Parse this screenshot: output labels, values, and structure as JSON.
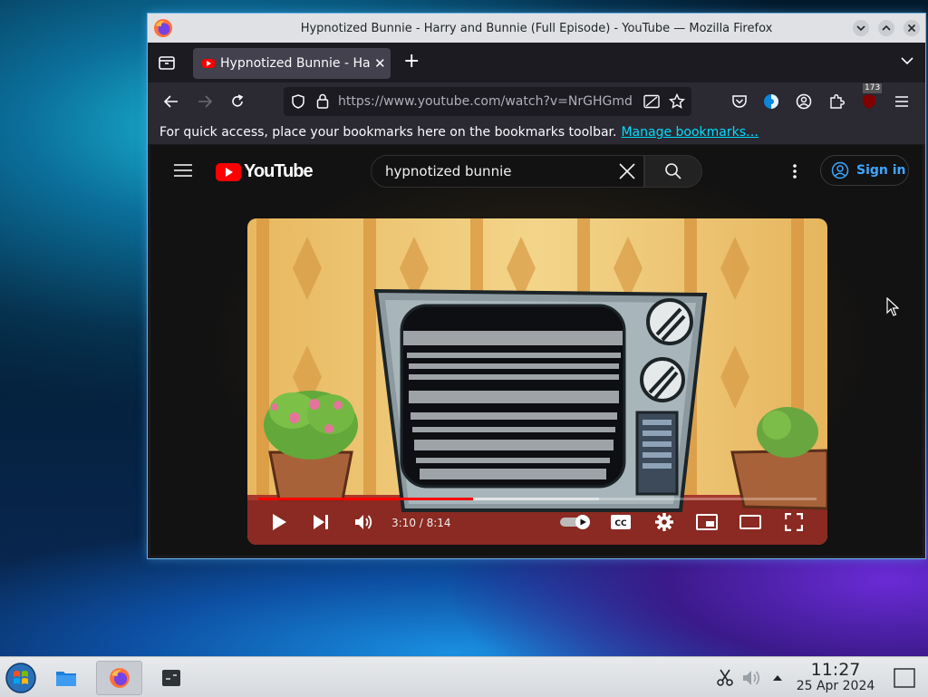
{
  "window": {
    "title": "Hypnotized Bunnie - Harry and Bunnie (Full Episode) - YouTube — Mozilla Firefox"
  },
  "tab": {
    "title": "Hypnotized Bunnie - Harry and Bunnie (Full Episode)",
    "close_glyph": "✕",
    "new_tab_glyph": "+"
  },
  "navbar": {
    "url": "https://www.youtube.com/watch?v=NrGHGmd",
    "extension_badge": "173"
  },
  "bookmarks_bar": {
    "message": "For quick access, place your bookmarks here on the bookmarks toolbar.",
    "manage_link": "Manage bookmarks…"
  },
  "youtube": {
    "logo_text": "YouTube",
    "search_value": "hypnotized bunnie",
    "sign_in": "Sign in"
  },
  "player": {
    "time": "3:10 / 8:14",
    "progress_played": 0.385,
    "progress_buffered": 0.61
  },
  "taskbar": {
    "time": "11:27",
    "date": "25 Apr 2024"
  },
  "colors": {
    "yt_red": "#ff0000",
    "link_cyan": "#00ddff",
    "signin_blue": "#3ea6ff"
  }
}
